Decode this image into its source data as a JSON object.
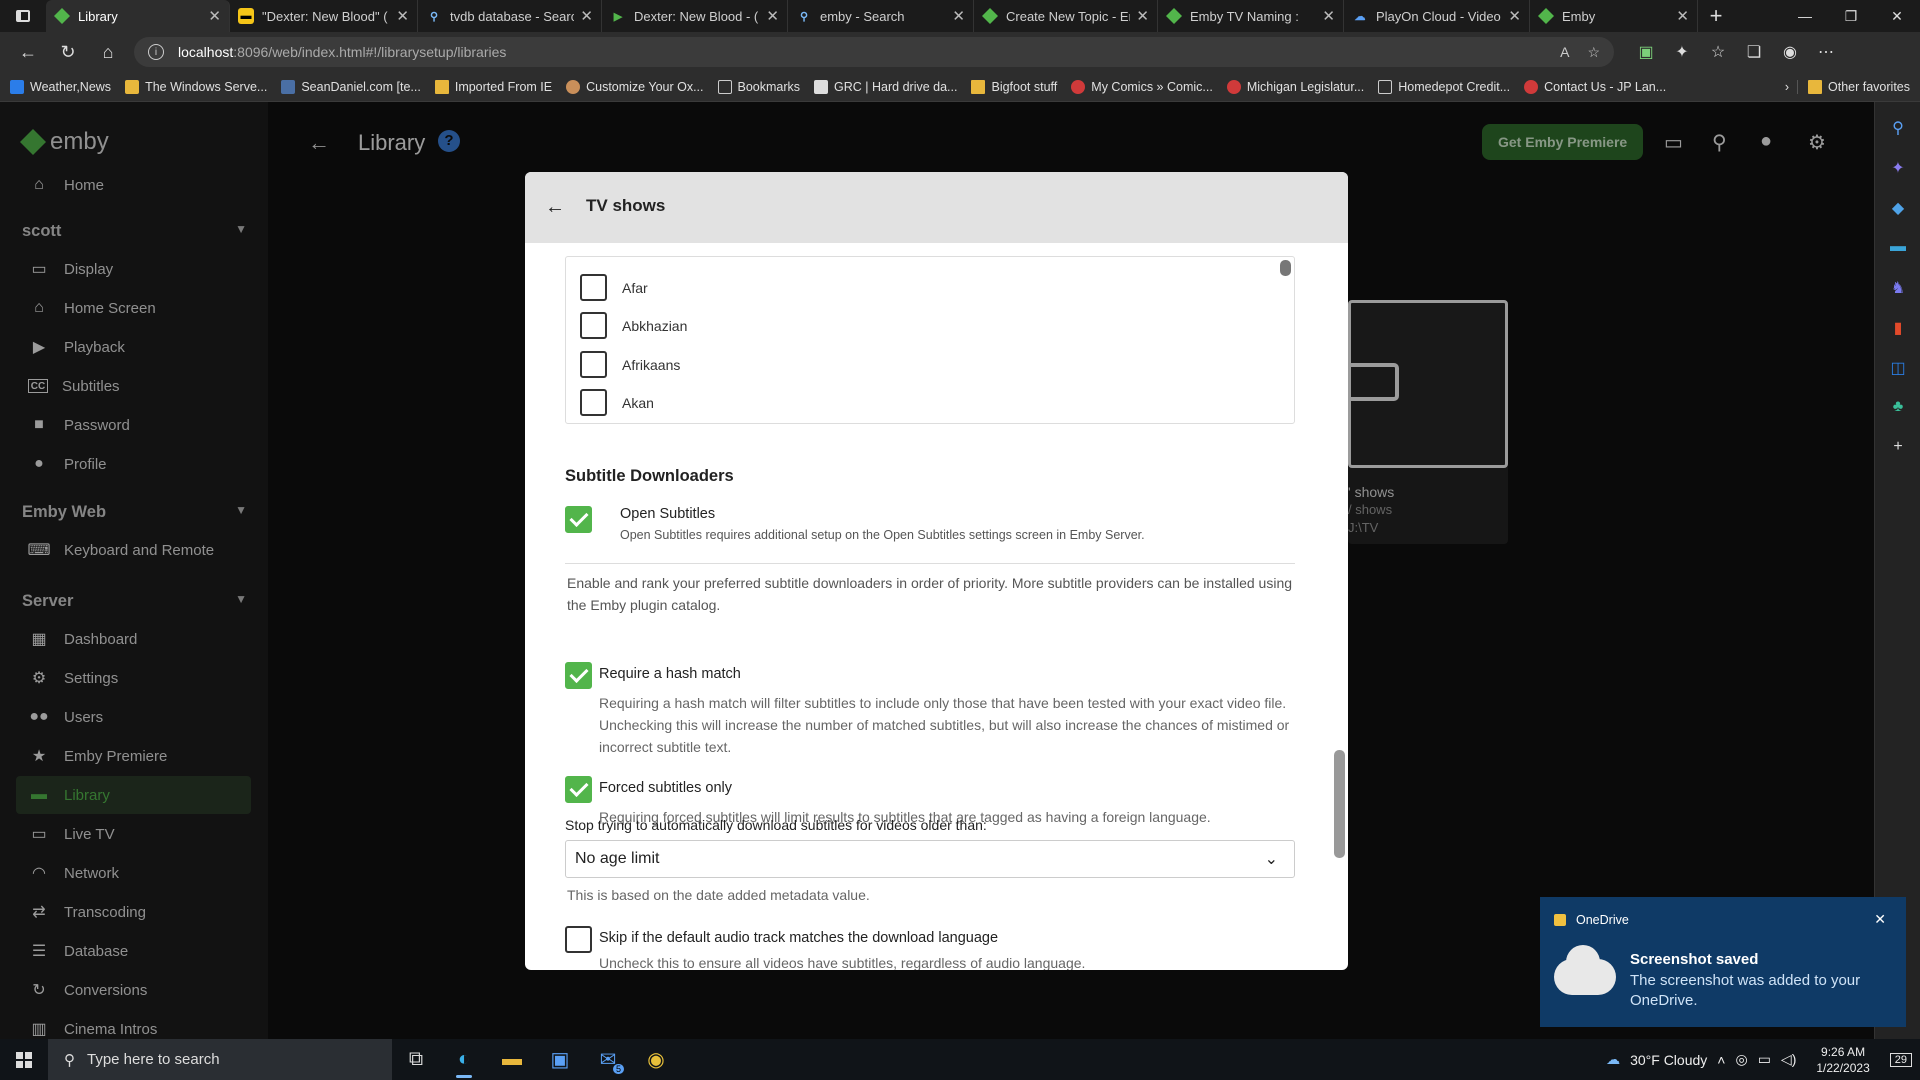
{
  "browser": {
    "tabs": [
      {
        "title": "Library",
        "favicon": "emby-icon",
        "active": true
      },
      {
        "title": "\"Dexter: New Blood\" (",
        "favicon": "imdb-icon"
      },
      {
        "title": "tvdb database - Search",
        "favicon": "search-icon"
      },
      {
        "title": "Dexter: New Blood - (",
        "favicon": "dexter-icon"
      },
      {
        "title": "emby - Search",
        "favicon": "search-icon"
      },
      {
        "title": "Create New Topic - Em",
        "favicon": "emby-icon"
      },
      {
        "title": "Emby TV Naming :",
        "favicon": "emby-icon"
      },
      {
        "title": "PlayOn Cloud - Video",
        "favicon": "playon-icon"
      },
      {
        "title": "Emby",
        "favicon": "emby-icon"
      }
    ],
    "url_host": "localhost",
    "url_path": ":8096/web/index.html#!/librarysetup/libraries",
    "bookmarks": [
      {
        "label": "Weather,News",
        "icon": "microsoft-icon"
      },
      {
        "label": "The Windows Serve...",
        "icon": "windows-icon"
      },
      {
        "label": "SeanDaniel.com [te...",
        "icon": "site-icon"
      },
      {
        "label": "Imported From IE",
        "icon": "folder-icon"
      },
      {
        "label": "Customize Your Ox...",
        "icon": "site-icon"
      },
      {
        "label": "Bookmarks",
        "icon": "page-icon"
      },
      {
        "label": "GRC | Hard drive da...",
        "icon": "site-icon"
      },
      {
        "label": "Bigfoot stuff",
        "icon": "folder-icon"
      },
      {
        "label": "My Comics » Comic...",
        "icon": "site-icon"
      },
      {
        "label": "Michigan Legislatur...",
        "icon": "site-icon"
      },
      {
        "label": "Homedepot Credit...",
        "icon": "page-icon"
      },
      {
        "label": "Contact Us - JP Lan...",
        "icon": "site-icon"
      }
    ],
    "other_favorites": "Other favorites"
  },
  "emby": {
    "logo": "emby",
    "home": "Home",
    "user_section": "scott",
    "user_items": [
      "Display",
      "Home Screen",
      "Playback",
      "Subtitles",
      "Password",
      "Profile"
    ],
    "web_section": "Emby Web",
    "web_items": [
      "Keyboard and Remote"
    ],
    "server_section": "Server",
    "server_items": [
      "Dashboard",
      "Settings",
      "Users",
      "Emby Premiere",
      "Library",
      "Live TV",
      "Network",
      "Transcoding",
      "Database",
      "Conversions",
      "Cinema Intros"
    ],
    "page_title": "Library",
    "premiere_button": "Get Emby Premiere",
    "library_card": {
      "name": "' shows",
      "type": "/ shows",
      "path": "J:\\TV"
    }
  },
  "dialog": {
    "title": "TV shows",
    "languages": [
      {
        "name": "Afar",
        "checked": false
      },
      {
        "name": "Abkhazian",
        "checked": false
      },
      {
        "name": "Afrikaans",
        "checked": false
      },
      {
        "name": "Akan",
        "checked": false
      }
    ],
    "downloaders_heading": "Subtitle Downloaders",
    "open_subtitles": {
      "name": "Open Subtitles",
      "desc": "Open Subtitles requires additional setup on the Open Subtitles settings screen in Emby Server.",
      "checked": true
    },
    "downloaders_help": "Enable and rank your preferred subtitle downloaders in order of priority. More subtitle providers can be installed using the Emby plugin catalog.",
    "hash_match": {
      "label": "Require a hash match",
      "desc": "Requiring a hash match will filter subtitles to include only those that have been tested with your exact video file. Unchecking this will increase the number of matched subtitles, but will also increase the chances of mistimed or incorrect subtitle text.",
      "checked": true
    },
    "forced_only": {
      "label": "Forced subtitles only",
      "desc": "Requiring forced subtitles will limit results to subtitles that are tagged as having a foreign language.",
      "checked": true
    },
    "age_label": "Stop trying to automatically download subtitles for videos older than:",
    "age_value": "No age limit",
    "age_note": "This is based on the date added metadata value.",
    "skip_audio": {
      "label": "Skip if the default audio track matches the download language",
      "desc": "Uncheck this to ensure all videos have subtitles, regardless of audio language.",
      "checked": false
    }
  },
  "toast": {
    "app": "OneDrive",
    "title": "Screenshot saved",
    "body": "The screenshot was added to your OneDrive."
  },
  "taskbar": {
    "search_placeholder": "Type here to search",
    "weather": "30°F  Cloudy",
    "time": "9:26 AM",
    "date": "1/22/2023",
    "notification_count": "29",
    "mail_badge": "5"
  },
  "colors": {
    "emby_green": "#52b54b",
    "toast_bg": "#0f3a66"
  }
}
